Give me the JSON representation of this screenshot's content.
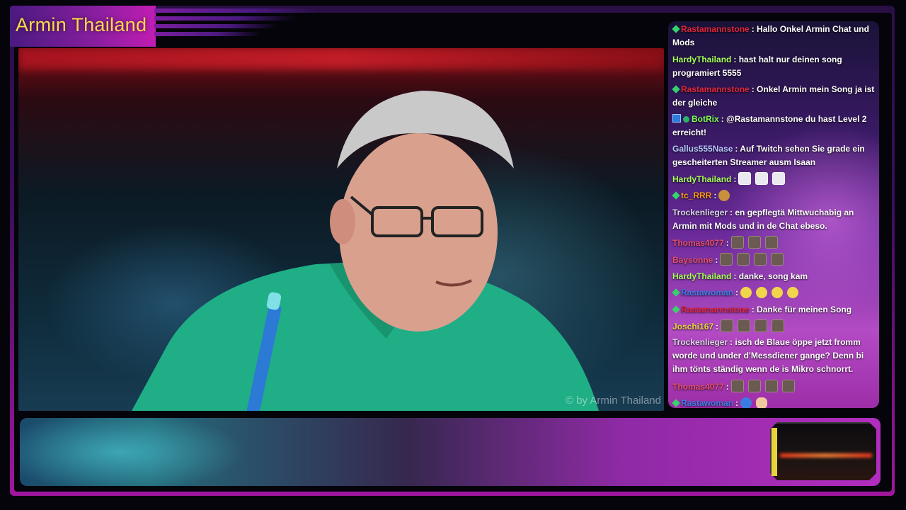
{
  "overlay": {
    "brand_title": "Armin Thailand",
    "watermark": "© by Armin Thailand",
    "colors": {
      "accent_purple": "#8a1ea0",
      "accent_magenta": "#c21db3",
      "brand_text": "#ffd84a",
      "shirt_green": "#21b58a"
    }
  },
  "chat": {
    "messages": [
      {
        "user": "Rastamannstone",
        "user_color": "#e2253a",
        "badges": [
          "green-diamond"
        ],
        "text": ": Hallo Onkel Armin Chat und Mods",
        "emotes": []
      },
      {
        "user": "HardyThailand",
        "user_color": "#a6ff5a",
        "badges": [],
        "text": ": hast halt nur deinen song programiert 5555",
        "emotes": []
      },
      {
        "user": "Rastamannstone",
        "user_color": "#e2253a",
        "badges": [
          "green-diamond"
        ],
        "text": ": Onkel Armin mein Song ja ist der gleiche",
        "emotes": []
      },
      {
        "user": "BotRix",
        "user_color": "#7dff54",
        "badges": [
          "bot-box",
          "verified"
        ],
        "text": ": @Rastamannstone du hast Level 2 erreicht!",
        "emotes": []
      },
      {
        "user": "Gallus555Nase",
        "user_color": "#b8c7ff",
        "badges": [],
        "text": ": Auf Twitch sehen Sie grade ein gescheiterten Streamer ausm Isaan",
        "emotes": []
      },
      {
        "user": "HardyThailand",
        "user_color": "#a6ff5a",
        "badges": [],
        "text": ":",
        "emotes": [
          "ghost",
          "ghost",
          "ghost"
        ]
      },
      {
        "user": "tc_RRR",
        "user_color": "#ff9a1a",
        "badges": [
          "green-diamond"
        ],
        "text": ":",
        "emotes": [
          "face"
        ]
      },
      {
        "user": "Trockenlieger",
        "user_color": "#d9d9e6",
        "badges": [],
        "text": ": en gepflegtä Mittwuchabig an Armin mit Mods und in de Chat ebeso.",
        "emotes": []
      },
      {
        "user": "Thomas4077",
        "user_color": "#e8506e",
        "badges": [],
        "text": ":",
        "emotes": [
          "box",
          "box",
          "box"
        ]
      },
      {
        "user": "Baysonne",
        "user_color": "#e8506e",
        "badges": [],
        "text": ":",
        "emotes": [
          "box",
          "box",
          "box",
          "box"
        ]
      },
      {
        "user": "HardyThailand",
        "user_color": "#a6ff5a",
        "badges": [],
        "text": ": danke, song kam",
        "emotes": []
      },
      {
        "user": "Rastawoman",
        "user_color": "#3d7de6",
        "badges": [
          "green-diamond"
        ],
        "text": ":",
        "emotes": [
          "yellow",
          "yellow",
          "yellow",
          "yellow"
        ]
      },
      {
        "user": "Rastamannstone",
        "user_color": "#e2253a",
        "badges": [
          "green-diamond"
        ],
        "text": ": Danke für meinen Song",
        "emotes": []
      },
      {
        "user": "Joschi167",
        "user_color": "#e6d640",
        "badges": [],
        "text": ":",
        "emotes": [
          "box",
          "box",
          "box",
          "box"
        ]
      },
      {
        "user": "Trockenlieger",
        "user_color": "#d9d9e6",
        "badges": [],
        "text": ": isch de Blaue öppe jetzt fromm worde und under d'Messdiener gange? Denn bi ihm tönts ständig wenn de is Mikro schnorrt.",
        "emotes": []
      },
      {
        "user": "Thomas4077",
        "user_color": "#e8506e",
        "badges": [],
        "text": ":",
        "emotes": [
          "box",
          "box",
          "box",
          "box"
        ]
      },
      {
        "user": "Rastawoman",
        "user_color": "#3d7de6",
        "badges": [
          "green-diamond"
        ],
        "text": ":",
        "emotes": [
          "heart",
          "hand"
        ]
      }
    ]
  }
}
